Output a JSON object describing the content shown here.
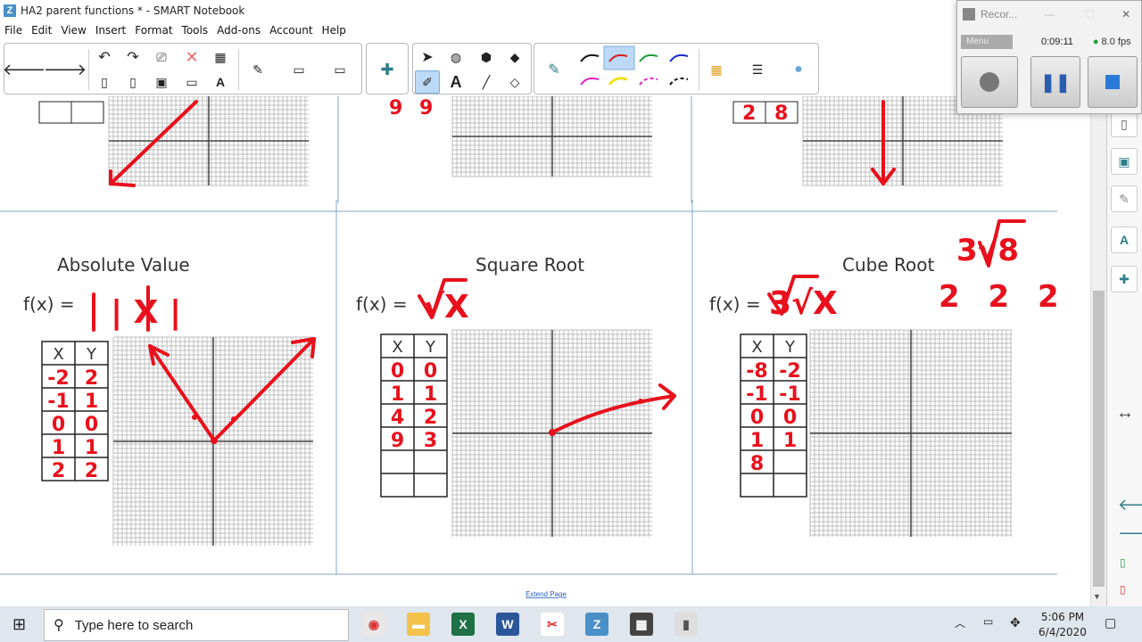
{
  "window": {
    "title": "HA2 parent functions * - SMART Notebook"
  },
  "menu": [
    "File",
    "Edit",
    "View",
    "Insert",
    "Format",
    "Tools",
    "Add-ons",
    "Account",
    "Help"
  ],
  "panels": {
    "absolute": {
      "title": "Absolute Value",
      "formula": "f(x) =",
      "col_x": "X",
      "col_y": "Y",
      "hand_expr": "| X |"
    },
    "sqrt": {
      "title": "Square Root",
      "formula": "f(x) =",
      "col_x": "X",
      "col_y": "Y",
      "hand_expr": "√X"
    },
    "cbrt": {
      "title": "Cube Root",
      "formula": "f(x) =",
      "col_x": "X",
      "col_y": "Y",
      "hand_expr": "3√X",
      "note_radical": "3√8",
      "note_factors": "2 2 2"
    }
  },
  "handwritten_tables": {
    "absolute": {
      "x": [
        "-2",
        "-1",
        "0",
        "1",
        "2"
      ],
      "y": [
        "2",
        "1",
        "0",
        "1",
        "2"
      ]
    },
    "sqrt": {
      "x": [
        "0",
        "1",
        "4",
        "9"
      ],
      "y": [
        "0",
        "1",
        "2",
        "3"
      ]
    },
    "cbrt": {
      "x": [
        "-8",
        "-1",
        "0",
        "1",
        "8"
      ],
      "y": [
        "-2",
        "-1",
        "0",
        "1",
        ""
      ]
    },
    "top_left_partial": [
      "9",
      "9"
    ],
    "top_right_partial": [
      "2",
      "8"
    ]
  },
  "extend_page": "Extend Page",
  "recorder": {
    "title": "Recor...",
    "menu": "Menu",
    "time": "0:09:11",
    "fps": "8.0 fps"
  },
  "taskbar": {
    "search_placeholder": "Type here to search",
    "time": "5:06 PM",
    "date": "6/4/2020"
  },
  "colors": {
    "ink": "#e8101c",
    "grid": "#bcbcbc",
    "panel_border": "#7fa6c7",
    "accent": "#4a90c8"
  }
}
